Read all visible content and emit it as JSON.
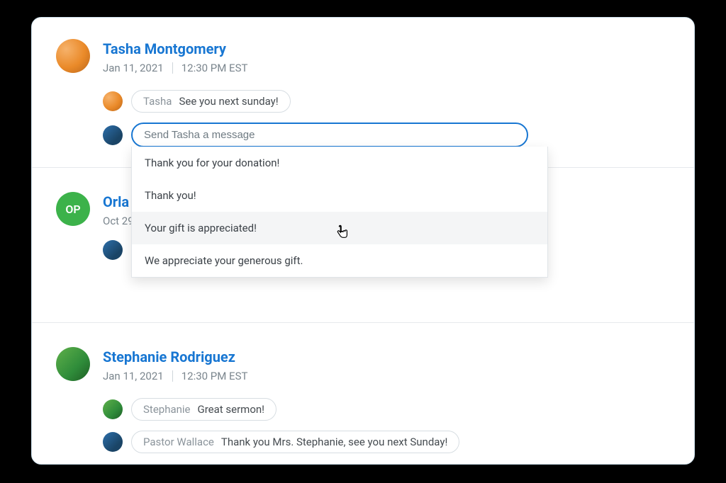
{
  "threads": [
    {
      "name": "Tasha Montgomery",
      "date": "Jan 11, 2021",
      "time": "12:30 PM EST",
      "initials": "",
      "messages": [
        {
          "sender": "Tasha",
          "text": "See you next sunday!"
        }
      ],
      "input_placeholder": "Send Tasha a message",
      "suggestions": [
        "Thank you for your donation!",
        "Thank you!",
        "Your gift is appreciated!",
        "We appreciate your generous gift."
      ],
      "hovered_suggestion_index": 2
    },
    {
      "name": "Orlando Palmer",
      "name_visible_prefix": "Orla",
      "date_visible_prefix": "Oct 29",
      "initials": "OP"
    },
    {
      "name": "Stephanie Rodriguez",
      "date": "Jan 11, 2021",
      "time": "12:30 PM EST",
      "messages": [
        {
          "sender": "Stephanie",
          "text": "Great sermon!"
        },
        {
          "sender": "Pastor Wallace",
          "text": "Thank you Mrs. Stephanie, see you next Sunday!"
        }
      ]
    }
  ],
  "colors": {
    "link": "#1776d2",
    "initials_bg": "#3cb24a"
  }
}
